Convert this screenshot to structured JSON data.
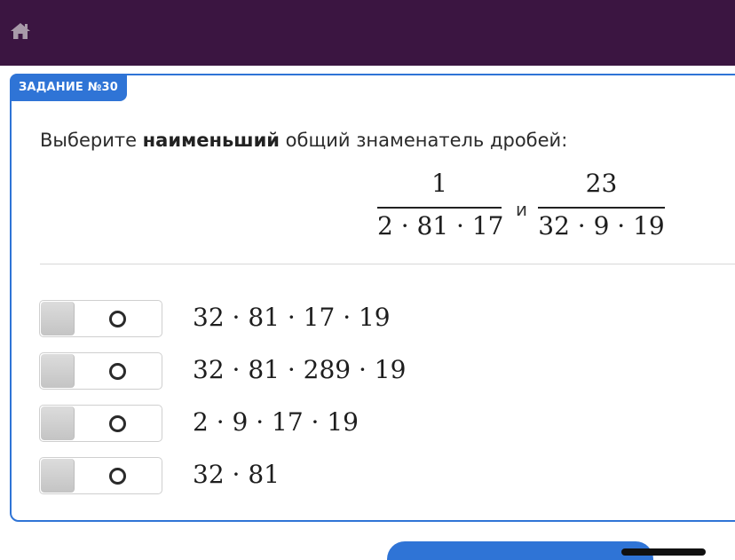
{
  "header": {
    "home_icon": "home-icon",
    "background_color": "#3b1541"
  },
  "task": {
    "badge": "ЗАДАНИЕ №30",
    "accent_color": "#2f74d6"
  },
  "question": {
    "prefix": "Выберите ",
    "emphasis": "наименьший",
    "suffix": " общий знаменатель дробей:"
  },
  "fractions": [
    {
      "numerator": "1",
      "denominator": "2 · 81 · 17"
    },
    {
      "numerator": "23",
      "denominator": "32 · 9 · 19"
    }
  ],
  "conjunction": "и",
  "options": [
    {
      "label": "32 · 81 · 17 · 19",
      "checked": false
    },
    {
      "label": "32 · 81 · 289 · 19",
      "checked": false
    },
    {
      "label": "2 · 9 · 17 · 19",
      "checked": false
    },
    {
      "label": "32 · 81",
      "checked": false
    }
  ]
}
